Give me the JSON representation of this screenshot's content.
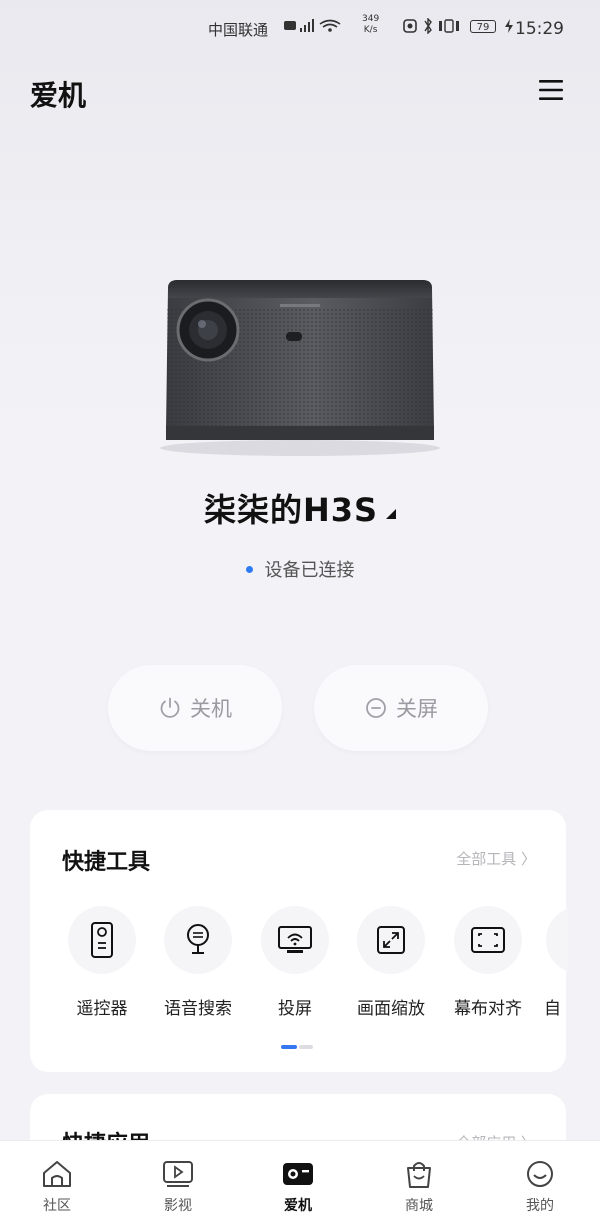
{
  "status_bar": {
    "carrier": "中国联通",
    "speed_value": "349",
    "speed_unit": "K/s",
    "battery": "79",
    "time": "15:29"
  },
  "header": {
    "title": "爱机",
    "menu_icon": "hamburger-menu-icon"
  },
  "device": {
    "name": "柒柒的H3S",
    "connection_status": "设备已连接",
    "status_color": "#2f7bf6"
  },
  "actions": {
    "power_off": "关机",
    "screen_off": "关屏"
  },
  "quick_tools": {
    "title": "快捷工具",
    "link": "全部工具 〉",
    "items": [
      {
        "label": "遥控器",
        "icon": "remote-icon"
      },
      {
        "label": "语音搜索",
        "icon": "voice-search-icon"
      },
      {
        "label": "投屏",
        "icon": "cast-icon"
      },
      {
        "label": "画面缩放",
        "icon": "zoom-icon"
      },
      {
        "label": "幕布对齐",
        "icon": "screen-align-icon"
      },
      {
        "label": "自",
        "icon": "partial-icon"
      }
    ]
  },
  "quick_apps": {
    "title": "快捷应用",
    "link": "全部应用 〉"
  },
  "tab_bar": {
    "items": [
      {
        "label": "社区",
        "icon": "home-icon"
      },
      {
        "label": "影视",
        "icon": "video-icon"
      },
      {
        "label": "爱机",
        "icon": "projector-icon"
      },
      {
        "label": "商城",
        "icon": "shopping-bag-icon"
      },
      {
        "label": "我的",
        "icon": "profile-icon"
      }
    ],
    "active_index": 2
  },
  "colors": {
    "accent": "#3577f0",
    "background": "#f3f3f7"
  }
}
